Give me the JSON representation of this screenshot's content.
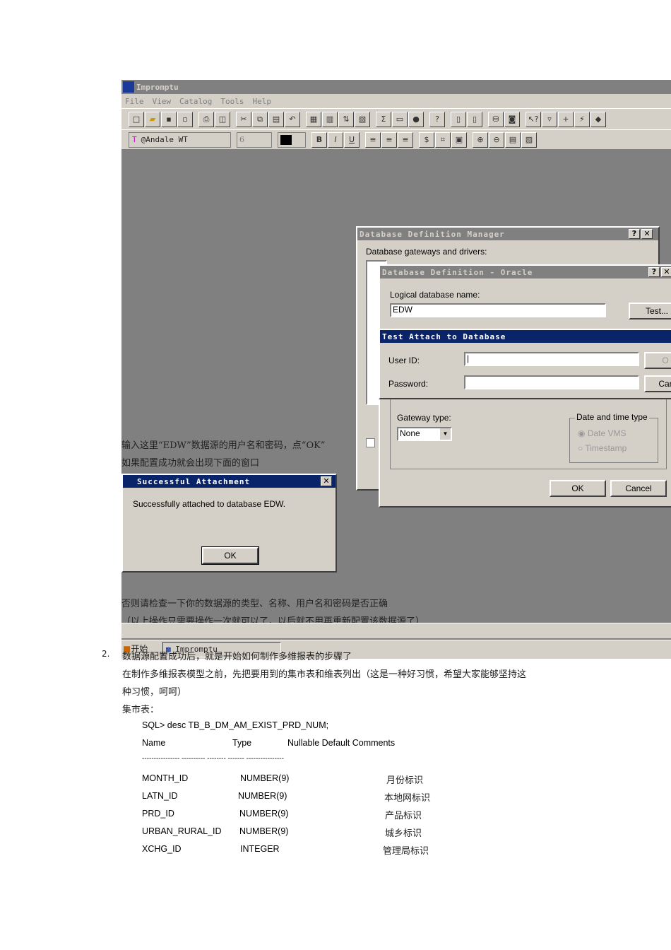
{
  "app": {
    "title": "Impromptu",
    "menu": [
      "File",
      "View",
      "Catalog",
      "Tools",
      "Help"
    ],
    "font_name": "@Andale WT",
    "font_size": "6",
    "format_buttons": [
      "B",
      "I",
      "U"
    ]
  },
  "dbm": {
    "title": "Database Definition Manager",
    "label": "Database gateways and drivers:"
  },
  "oracle": {
    "title": "Database Definition - Oracle",
    "logical_label": "Logical database name:",
    "logical_value": "EDW",
    "test_button": "Test...",
    "gateway_label": "Gateway type:",
    "gateway_value": "None",
    "datetime_label": "Date and time type",
    "radio1": "Date VMS",
    "radio2": "Timestamp",
    "ok": "OK",
    "cancel": "Cancel"
  },
  "attach": {
    "title": "Test Attach to Database",
    "user_label": "User ID:",
    "password_label": "Password:",
    "ok": "O",
    "cancel": "Car"
  },
  "success": {
    "title": "Successful Attachment",
    "message": "Successfully attached to database EDW.",
    "ok": "OK"
  },
  "taskbar": {
    "start": "开始",
    "task": "Impromptu"
  },
  "overlay_notes": [
    "输入这里“EDW”数据源的用户名和密码，点“OK”",
    "如果配置成功就会出现下面的窗口",
    "否则请检查一下你的数据源的类型、名称、用户名和密码是否正确",
    "（以上操作只需要操作一次就可以了，以后就不用再重新配置该数据源了）"
  ],
  "doc": {
    "step_num": "2.",
    "step_text": "数据源配置成功后，就是开始如何制作多维报表的步骤了",
    "para1": "在制作多维报表模型之前，先把要用到的集市表和维表列出（这是一种好习惯，希望大家能够坚持这",
    "para2": "种习惯，呵呵）",
    "fact_label": "集市表：",
    "sql": "SQL> desc TB_B_DM_AM_EXIST_PRD_NUM;",
    "header": {
      "name": "Name",
      "type": "Type",
      "rest": "Nullable Default Comments"
    },
    "separator": "---------------- ---------- -------- ------- ----------------",
    "rows": [
      {
        "name": "MONTH_ID",
        "type": "NUMBER(9)",
        "comment": "月份标识"
      },
      {
        "name": "LATN_ID",
        "type": "NUMBER(9)",
        "comment": "本地网标识"
      },
      {
        "name": "PRD_ID",
        "type": "NUMBER(9)",
        "comment": "产品标识"
      },
      {
        "name": "URBAN_RURAL_ID",
        "type": "NUMBER(9)",
        "comment": "城乡标识"
      },
      {
        "name": "XCHG_ID",
        "type": "INTEGER",
        "comment": "管理局标识"
      }
    ]
  }
}
